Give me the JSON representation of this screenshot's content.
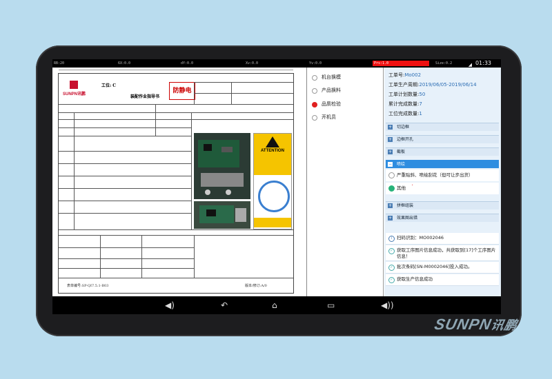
{
  "statusbar": {
    "time": "01:33",
    "segments": [
      "RB:20",
      "6X:0.0",
      "dY:0.0",
      "Xv:0.0",
      "Yv:0.0",
      "Prs:1.0",
      "Size:0.2"
    ]
  },
  "doc": {
    "logo": "SUNPN讯鹏",
    "title1": "工位: C",
    "title2": "装配作业指导书",
    "stamp": "防静电",
    "warning": "ATTENTION",
    "footer_left": "表单编号:SP-QI7.5.1-B03",
    "footer_right": "版本/修订:A/0"
  },
  "stations": [
    {
      "label": "机台换模",
      "selected": false
    },
    {
      "label": "产品换料",
      "selected": false
    },
    {
      "label": "品质检验",
      "selected": true
    },
    {
      "label": "开机员",
      "selected": false
    }
  ],
  "workorder": {
    "no_label": "工单号:",
    "no_value": "Mo002",
    "period_label": "工单生产周期:",
    "period_value": "2019/06/05-2019/06/14",
    "plan_label": "工单计划数量:",
    "plan_value": "50",
    "total_label": "累计完成数量:",
    "total_value": "7",
    "station_label": "工位完成数量:",
    "station_value": "1"
  },
  "sections": [
    {
      "label": "切边框",
      "open": false
    },
    {
      "label": "边框开孔",
      "open": false
    },
    {
      "label": "截板",
      "open": false
    },
    {
      "label": "喷绘",
      "open": true
    }
  ],
  "subitems": [
    {
      "label": "严重贴斜、喷绘刮花（但可让步出货）",
      "checked": false
    },
    {
      "label": "其他",
      "checked": true,
      "note": "'"
    }
  ],
  "sections2": [
    {
      "label": "拼框组装"
    },
    {
      "label": "效果图出错"
    }
  ],
  "logs": [
    {
      "type": "info",
      "text": "扫码识别：MO002046"
    },
    {
      "type": "ok",
      "text": "获取工序图片信息成功，共获取到[17]个工序图片信息！"
    },
    {
      "type": "ok",
      "text": "批次条码[SN-M0002046]投入成功。"
    },
    {
      "type": "ok",
      "text": "获取生产信息成功"
    }
  ],
  "brand": {
    "latin": "SUNPN",
    "cn": "讯鹏"
  }
}
